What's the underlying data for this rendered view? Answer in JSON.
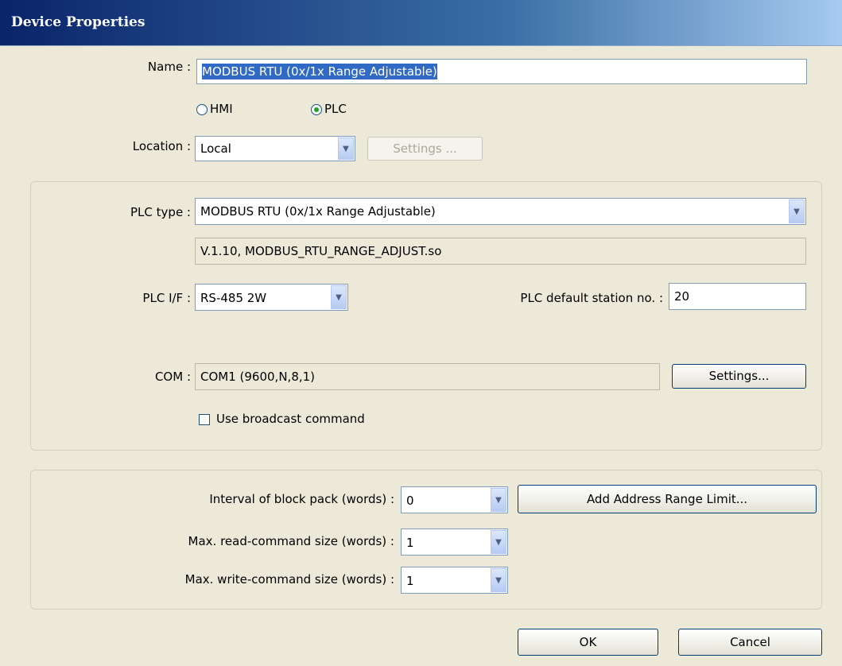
{
  "window": {
    "title": "Device Properties"
  },
  "name": {
    "label": "Name :",
    "value": "MODBUS RTU (0x/1x Range Adjustable)"
  },
  "device_kind": {
    "options": [
      "HMI",
      "PLC"
    ],
    "selected": "PLC"
  },
  "location": {
    "label": "Location :",
    "value": "Local",
    "settings_button": "Settings ..."
  },
  "plc": {
    "type_label": "PLC type :",
    "type_value": "MODBUS RTU (0x/1x Range Adjustable)",
    "driver_info": "V.1.10, MODBUS_RTU_RANGE_ADJUST.so",
    "if_label": "PLC I/F :",
    "if_value": "RS-485 2W",
    "station_label": "PLC default station no. :",
    "station_value": "20",
    "com_label": "COM :",
    "com_value": "COM1 (9600,N,8,1)",
    "com_settings_button": "Settings...",
    "broadcast_label": "Use broadcast command",
    "broadcast_checked": false
  },
  "block": {
    "interval_label": "Interval of block pack (words) :",
    "interval_value": "0",
    "add_range_button": "Add Address Range Limit...",
    "max_read_label": "Max. read-command size (words) :",
    "max_read_value": "1",
    "max_write_label": "Max. write-command size (words) :",
    "max_write_value": "1"
  },
  "footer": {
    "ok_button": "OK",
    "cancel_button": "Cancel"
  },
  "colors": {
    "window_bg": "#ECE9D8",
    "title_start": "#0A246A",
    "title_end": "#A6CAF0",
    "radio_dot": "#21A121",
    "selection": "#316AC5"
  }
}
